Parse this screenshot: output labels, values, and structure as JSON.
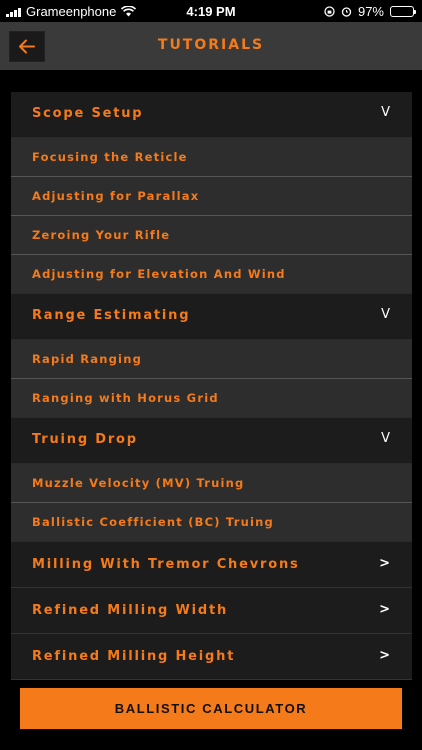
{
  "status_bar": {
    "carrier": "Grameenphone",
    "time": "4:19 PM",
    "battery": "97%",
    "battery_level": 0.97,
    "battery_color": "#4cd964"
  },
  "nav": {
    "title": "TUTORIALS",
    "back_icon": "arrow-left-icon"
  },
  "colors": {
    "accent": "#f47a1a",
    "header_bg": "#1c1c1c",
    "item_bg": "#2d2d2d",
    "nav_bg": "#3a3a3a"
  },
  "sections": [
    {
      "title": "Scope Setup",
      "toggle": "V",
      "items": [
        "Focusing the Reticle",
        "Adjusting for Parallax",
        "Zeroing Your Rifle",
        "Adjusting for Elevation And Wind"
      ]
    },
    {
      "title": "Range Estimating",
      "toggle": "V",
      "items": [
        "Rapid Ranging",
        "Ranging with Horus Grid"
      ]
    },
    {
      "title": "Truing Drop",
      "toggle": "V",
      "items": [
        "Muzzle Velocity (MV) Truing",
        "Ballistic Coefficient (BC) Truing"
      ]
    }
  ],
  "links": [
    {
      "title": "Milling With Tremor Chevrons",
      "chevron": ">"
    },
    {
      "title": "Refined Milling Width",
      "chevron": ">"
    },
    {
      "title": "Refined Milling Height",
      "chevron": ">"
    }
  ],
  "calculator_button": "BALLISTIC CALCULATOR"
}
